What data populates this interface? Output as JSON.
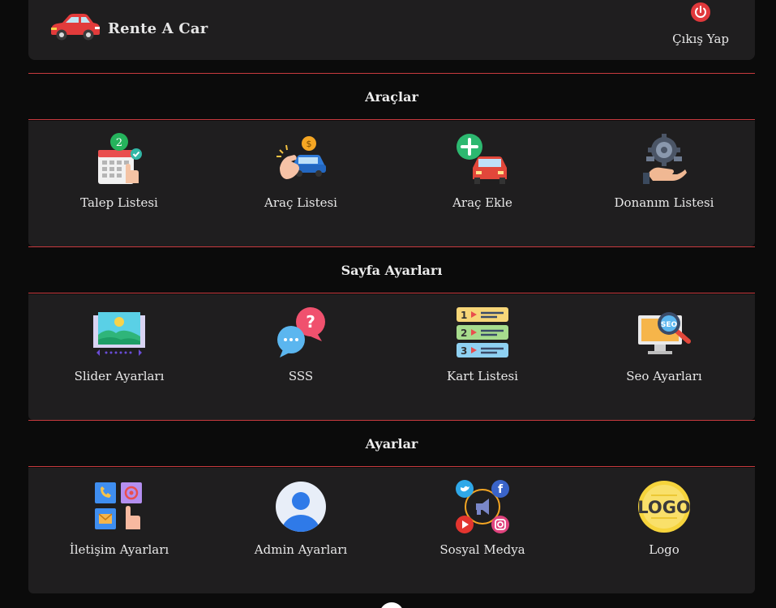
{
  "header": {
    "brand": "Rente A Car",
    "logout_label": "Çıkış Yap"
  },
  "sections": {
    "araclar": {
      "title": "Araçlar",
      "items": [
        {
          "label": "Talep Listesi",
          "icon": "calendar-request-icon",
          "badge": "2"
        },
        {
          "label": "Araç Listesi",
          "icon": "car-price-icon"
        },
        {
          "label": "Araç Ekle",
          "icon": "add-car-icon"
        },
        {
          "label": "Donanım Listesi",
          "icon": "gear-hardware-icon"
        }
      ]
    },
    "sayfa": {
      "title": "Sayfa Ayarları",
      "items": [
        {
          "label": "Slider Ayarları",
          "icon": "image-slider-icon"
        },
        {
          "label": "SSS",
          "icon": "faq-chat-icon"
        },
        {
          "label": "Kart Listesi",
          "icon": "numbered-list-icon"
        },
        {
          "label": "Seo Ayarları",
          "icon": "seo-search-icon"
        }
      ]
    },
    "ayarlar": {
      "title": "Ayarlar",
      "items": [
        {
          "label": "İletişim Ayarları",
          "icon": "contact-icon"
        },
        {
          "label": "Admin Ayarları",
          "icon": "admin-user-icon"
        },
        {
          "label": "Sosyal Medya",
          "icon": "social-media-icon"
        },
        {
          "label": "Logo",
          "icon": "logo-icon",
          "logo_text": "LOGO"
        }
      ]
    }
  },
  "colors": {
    "accent_line": "#c83a3e",
    "panel": "#1f1e1f",
    "background": "#0b0b0b"
  }
}
